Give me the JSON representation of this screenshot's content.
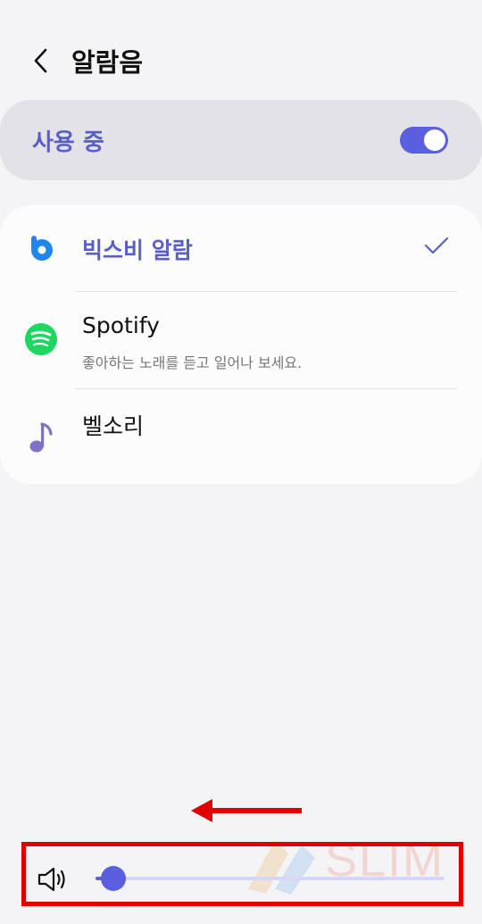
{
  "header": {
    "title": "알람음",
    "back_icon": "chevron-left-icon"
  },
  "master_switch": {
    "label": "사용 중",
    "enabled": true
  },
  "options": [
    {
      "title": "빅스비 알람",
      "subtitle": "",
      "icon": "bixby-icon",
      "selected": true
    },
    {
      "title": "Spotify",
      "subtitle": "좋아하는 노래를 듣고 일어나 보세요.",
      "icon": "spotify-icon",
      "selected": false
    },
    {
      "title": "벨소리",
      "subtitle": "",
      "icon": "music-note-icon",
      "selected": false
    }
  ],
  "volume": {
    "icon": "speaker-icon",
    "level": 0.05
  },
  "annotation": {
    "arrow_direction": "left",
    "highlight_color": "#e00000"
  },
  "watermark": {
    "text": "SLIM"
  },
  "colors": {
    "accent": "#5a5fe0",
    "label_accent": "#5a5fc8",
    "spotify": "#1ed760",
    "note": "#8070c8",
    "bixby": "#1f86f0"
  }
}
